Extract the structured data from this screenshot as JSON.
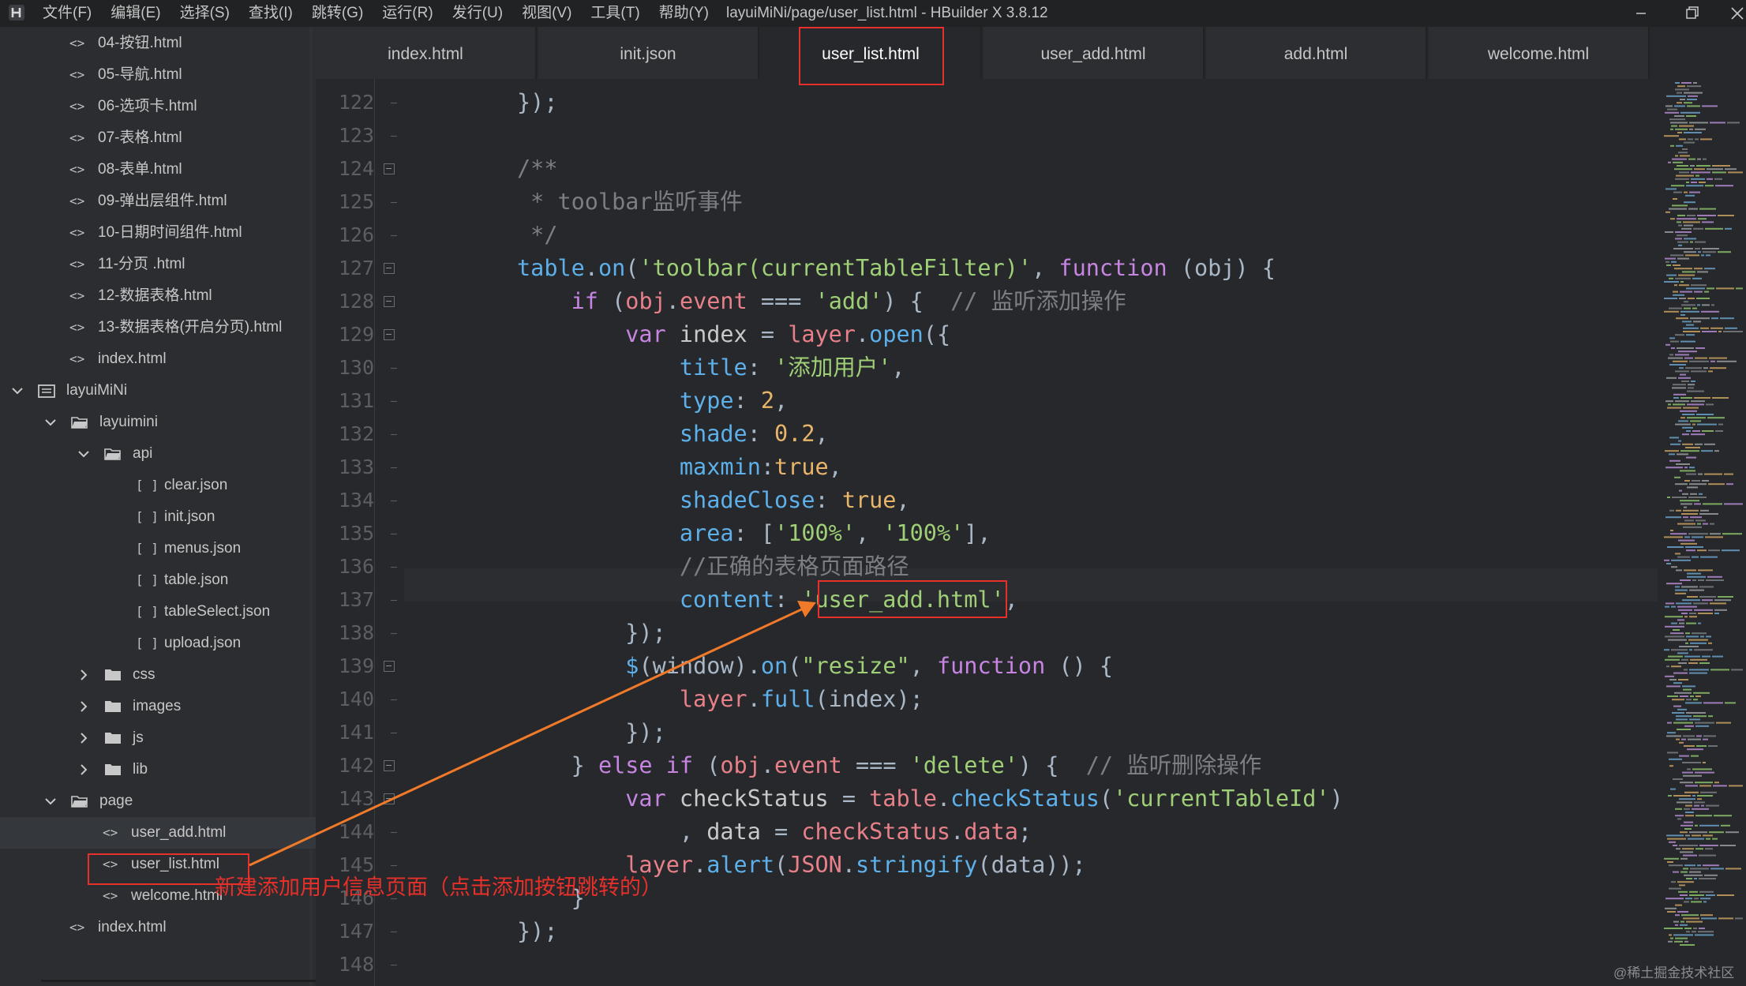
{
  "window": {
    "title": "layuiMiNi/page/user_list.html - HBuilder X 3.8.12",
    "menu": [
      "文件(F)",
      "编辑(E)",
      "选择(S)",
      "查找(I)",
      "跳转(G)",
      "运行(R)",
      "发行(U)",
      "视图(V)",
      "工具(T)",
      "帮助(Y)"
    ],
    "controls": [
      "minimize",
      "restore",
      "close"
    ]
  },
  "sidebar": {
    "items": [
      {
        "label": "04-按钮.html",
        "type": "html"
      },
      {
        "label": "05-导航.html",
        "type": "html"
      },
      {
        "label": "06-选项卡.html",
        "type": "html"
      },
      {
        "label": "07-表格.html",
        "type": "html"
      },
      {
        "label": "08-表单.html",
        "type": "html"
      },
      {
        "label": "09-弹出层组件.html",
        "type": "html"
      },
      {
        "label": "10-日期时间组件.html",
        "type": "html"
      },
      {
        "label": "11-分页 .html",
        "type": "html"
      },
      {
        "label": "12-数据表格.html",
        "type": "html"
      },
      {
        "label": "13-数据表格(开启分页).html",
        "type": "html"
      },
      {
        "label": "index.html",
        "type": "html"
      },
      {
        "label": "layuiMiNi",
        "type": "project"
      },
      {
        "label": "layuimini",
        "type": "folder-open"
      },
      {
        "label": "api",
        "type": "folder-open"
      },
      {
        "label": "clear.json",
        "type": "json"
      },
      {
        "label": "init.json",
        "type": "json"
      },
      {
        "label": "menus.json",
        "type": "json"
      },
      {
        "label": "table.json",
        "type": "json"
      },
      {
        "label": "tableSelect.json",
        "type": "json"
      },
      {
        "label": "upload.json",
        "type": "json"
      },
      {
        "label": "css",
        "type": "folder"
      },
      {
        "label": "images",
        "type": "folder"
      },
      {
        "label": "js",
        "type": "folder"
      },
      {
        "label": "lib",
        "type": "folder"
      },
      {
        "label": "page",
        "type": "folder-open-plain"
      },
      {
        "label": "user_add.html",
        "type": "html",
        "selected": true
      },
      {
        "label": "user_list.html",
        "type": "html"
      },
      {
        "label": "welcome.html",
        "type": "html"
      },
      {
        "label": "index.html",
        "type": "html"
      }
    ]
  },
  "tabs": [
    {
      "label": "index.html"
    },
    {
      "label": "init.json"
    },
    {
      "label": "user_list.html",
      "active": true
    },
    {
      "label": "user_add.html"
    },
    {
      "label": "add.html"
    },
    {
      "label": "welcome.html"
    }
  ],
  "editor": {
    "line_numbers": [
      "122",
      "123",
      "124",
      "125",
      "126",
      "127",
      "128",
      "129",
      "130",
      "131",
      "132",
      "133",
      "134",
      "135",
      "136",
      "137",
      "138",
      "139",
      "140",
      "141",
      "142",
      "143",
      "144",
      "145",
      "146",
      "147",
      "148"
    ],
    "fold_lines": [
      "124",
      "127",
      "128",
      "129",
      "139",
      "142",
      "143"
    ],
    "lines": [
      [
        [
          "c-punc",
          "});"
        ]
      ],
      [],
      [
        [
          "c-cmt",
          "/**"
        ]
      ],
      [
        [
          "c-cmt",
          " * toolbar监听事件"
        ]
      ],
      [
        [
          "c-cmt",
          " */"
        ]
      ],
      [
        [
          "c-fn",
          "table"
        ],
        [
          "c-punc",
          "."
        ],
        [
          "c-fn",
          "on"
        ],
        [
          "c-punc",
          "("
        ],
        [
          "c-str",
          "'toolbar(currentTableFilter)'"
        ],
        [
          "c-punc",
          ", "
        ],
        [
          "c-kw",
          "function"
        ],
        [
          "c-punc",
          " (obj) {"
        ]
      ],
      [
        [
          "c-kw",
          "    if"
        ],
        [
          "c-punc",
          " ("
        ],
        [
          "c-var",
          "obj"
        ],
        [
          "c-punc",
          "."
        ],
        [
          "c-var",
          "event"
        ],
        [
          "c-punc",
          " === "
        ],
        [
          "c-str",
          "'add'"
        ],
        [
          "c-punc",
          ") {  "
        ],
        [
          "c-cmt",
          "// 监听添加操作"
        ]
      ],
      [
        [
          "c-kw",
          "        var"
        ],
        [
          "c-plain",
          " index "
        ],
        [
          "c-punc",
          "= "
        ],
        [
          "c-var",
          "layer"
        ],
        [
          "c-punc",
          "."
        ],
        [
          "c-fn",
          "open"
        ],
        [
          "c-punc",
          "({"
        ]
      ],
      [
        [
          "c-prop",
          "            title"
        ],
        [
          "c-punc",
          ": "
        ],
        [
          "c-str",
          "'添加用户'"
        ],
        [
          "c-punc",
          ","
        ]
      ],
      [
        [
          "c-prop",
          "            type"
        ],
        [
          "c-punc",
          ": "
        ],
        [
          "c-num",
          "2"
        ],
        [
          "c-punc",
          ","
        ]
      ],
      [
        [
          "c-prop",
          "            shade"
        ],
        [
          "c-punc",
          ": "
        ],
        [
          "c-num",
          "0.2"
        ],
        [
          "c-punc",
          ","
        ]
      ],
      [
        [
          "c-prop",
          "            maxmin"
        ],
        [
          "c-punc",
          ":"
        ],
        [
          "c-bool",
          "true"
        ],
        [
          "c-punc",
          ","
        ]
      ],
      [
        [
          "c-prop",
          "            shadeClose"
        ],
        [
          "c-punc",
          ": "
        ],
        [
          "c-bool",
          "true"
        ],
        [
          "c-punc",
          ","
        ]
      ],
      [
        [
          "c-prop",
          "            area"
        ],
        [
          "c-punc",
          ": ["
        ],
        [
          "c-str",
          "'100%'"
        ],
        [
          "c-punc",
          ", "
        ],
        [
          "c-str",
          "'100%'"
        ],
        [
          "c-punc",
          "],"
        ]
      ],
      [
        [
          "c-cmt",
          "            //正确的表格页面路径"
        ]
      ],
      [
        [
          "c-prop",
          "            content"
        ],
        [
          "c-punc",
          ": "
        ],
        [
          "c-str",
          "'user_add.html'"
        ],
        [
          "c-punc",
          ","
        ]
      ],
      [
        [
          "c-punc",
          "        });"
        ]
      ],
      [
        [
          "c-fn",
          "        $"
        ],
        [
          "c-punc",
          "(window)."
        ],
        [
          "c-fn",
          "on"
        ],
        [
          "c-punc",
          "("
        ],
        [
          "c-str",
          "\"resize\""
        ],
        [
          "c-punc",
          ", "
        ],
        [
          "c-kw",
          "function"
        ],
        [
          "c-punc",
          " () {"
        ]
      ],
      [
        [
          "c-var",
          "            layer"
        ],
        [
          "c-punc",
          "."
        ],
        [
          "c-fn",
          "full"
        ],
        [
          "c-punc",
          "(index);"
        ]
      ],
      [
        [
          "c-punc",
          "        });"
        ]
      ],
      [
        [
          "c-punc",
          "    } "
        ],
        [
          "c-kw",
          "else if"
        ],
        [
          "c-punc",
          " ("
        ],
        [
          "c-var",
          "obj"
        ],
        [
          "c-punc",
          "."
        ],
        [
          "c-var",
          "event"
        ],
        [
          "c-punc",
          " === "
        ],
        [
          "c-str",
          "'delete'"
        ],
        [
          "c-punc",
          ") {  "
        ],
        [
          "c-cmt",
          "// 监听删除操作"
        ]
      ],
      [
        [
          "c-kw",
          "        var"
        ],
        [
          "c-plain",
          " checkStatus "
        ],
        [
          "c-punc",
          "= "
        ],
        [
          "c-var",
          "table"
        ],
        [
          "c-punc",
          "."
        ],
        [
          "c-fn",
          "checkStatus"
        ],
        [
          "c-punc",
          "("
        ],
        [
          "c-str",
          "'currentTableId'"
        ],
        [
          "c-punc",
          ")"
        ]
      ],
      [
        [
          "c-punc",
          "            , "
        ],
        [
          "c-plain",
          "data "
        ],
        [
          "c-punc",
          "= "
        ],
        [
          "c-var",
          "checkStatus"
        ],
        [
          "c-punc",
          "."
        ],
        [
          "c-var",
          "data"
        ],
        [
          "c-punc",
          ";"
        ]
      ],
      [
        [
          "c-var",
          "        layer"
        ],
        [
          "c-punc",
          "."
        ],
        [
          "c-fn",
          "alert"
        ],
        [
          "c-punc",
          "("
        ],
        [
          "c-var",
          "JSON"
        ],
        [
          "c-punc",
          "."
        ],
        [
          "c-fn",
          "stringify"
        ],
        [
          "c-punc",
          "(data));"
        ]
      ],
      [
        [
          "c-punc",
          "    }"
        ]
      ],
      [
        [
          "c-punc",
          "});"
        ]
      ],
      []
    ]
  },
  "annotation": {
    "text": "新建添加用户信息页面（点击添加按钮跳转的）"
  },
  "watermark": "@稀土掘金技术社区",
  "colors": {
    "annotation_red": "#e8302a",
    "arrow_orange": "#f07a2a",
    "background": "#26282b"
  }
}
